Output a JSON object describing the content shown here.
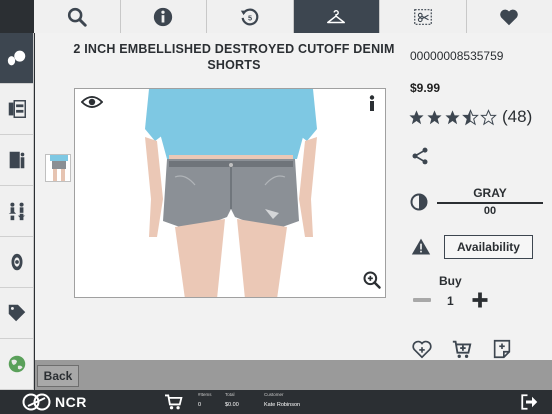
{
  "product": {
    "title": "2 INCH EMBELLISHED DESTROYED CUTOFF DENIM SHORTS",
    "sku": "00000008535759",
    "price": "$9.99",
    "rating": 3.5,
    "rating_count": "(48)",
    "color": "GRAY",
    "size": "00",
    "availability_label": "Availability",
    "buy_label": "Buy",
    "quantity": "1"
  },
  "back_label": "Back",
  "top_tabs": [
    {
      "icon": "search-icon",
      "active": false
    },
    {
      "icon": "info-icon",
      "active": false
    },
    {
      "icon": "history-icon",
      "active": false
    },
    {
      "icon": "hanger-icon",
      "active": true
    },
    {
      "icon": "coupon-icon",
      "active": false
    },
    {
      "icon": "heart-icon",
      "active": false
    }
  ],
  "sidebar": [
    {
      "icon": "customer-icon",
      "active": true
    },
    {
      "icon": "clothing-icon",
      "active": false
    },
    {
      "icon": "fitting-room-icon",
      "active": false
    },
    {
      "icon": "associates-icon",
      "active": false
    },
    {
      "icon": "eye-icon",
      "active": false
    },
    {
      "icon": "tag-icon",
      "active": false
    },
    {
      "icon": "globe-icon",
      "active": false
    }
  ],
  "footer": {
    "brand": "NCR",
    "items_label": "#Items",
    "items_value": "0",
    "total_label": "Total",
    "total_value": "$0.00",
    "customer_label": "Customer",
    "customer_value": "Kate Robinson"
  },
  "colors": {
    "dark": "#3d4650",
    "panel": "#f2f2f2",
    "accent": "#2b2f33"
  }
}
